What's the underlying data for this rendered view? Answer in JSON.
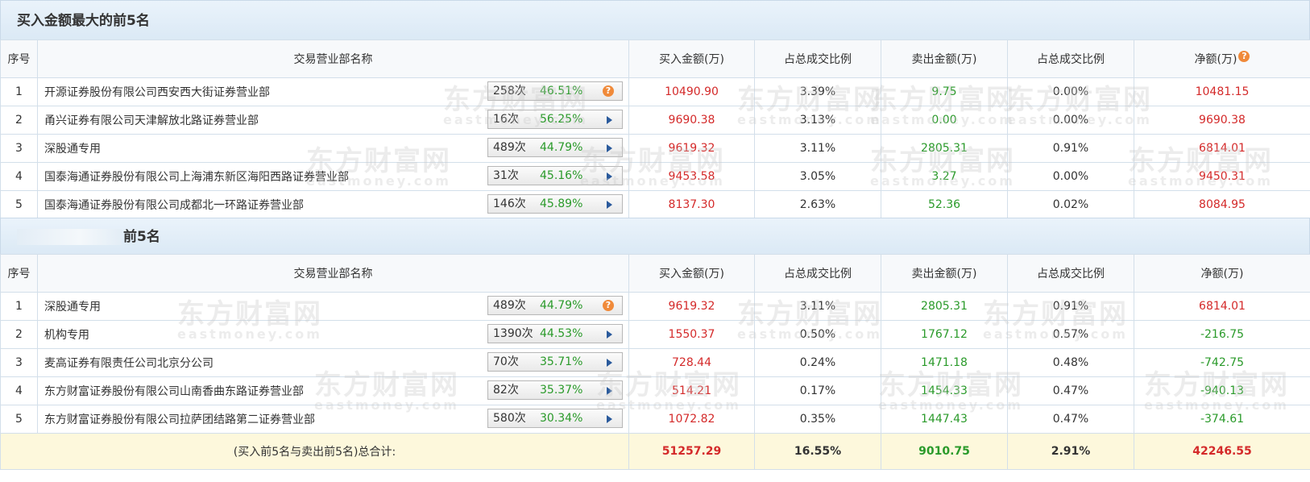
{
  "buy_section": {
    "title": "买入金额最大的前5名",
    "headers": [
      "序号",
      "交易营业部名称",
      "买入金额(万)",
      "占总成交比例",
      "卖出金额(万)",
      "占总成交比例",
      "净额(万)"
    ],
    "net_help_icon": "?",
    "rows": [
      {
        "no": "1",
        "name": "开源证券股份有限公司西安西大街证券营业部",
        "count": "258次",
        "pct": "46.51%",
        "icon": "help-icon",
        "buy": "10490.90",
        "buy_ratio": "3.39%",
        "sell": "9.75",
        "sell_ratio": "0.00%",
        "net": "10481.15"
      },
      {
        "no": "2",
        "name": "甬兴证券有限公司天津解放北路证券营业部",
        "count": "16次",
        "pct": "56.25%",
        "icon": "arrow-icon",
        "buy": "9690.38",
        "buy_ratio": "3.13%",
        "sell": "0.00",
        "sell_ratio": "0.00%",
        "net": "9690.38"
      },
      {
        "no": "3",
        "name": "深股通专用",
        "count": "489次",
        "pct": "44.79%",
        "icon": "arrow-icon",
        "buy": "9619.32",
        "buy_ratio": "3.11%",
        "sell": "2805.31",
        "sell_ratio": "0.91%",
        "net": "6814.01"
      },
      {
        "no": "4",
        "name": "国泰海通证券股份有限公司上海浦东新区海阳西路证券营业部",
        "count": "31次",
        "pct": "45.16%",
        "icon": "arrow-icon",
        "buy": "9453.58",
        "buy_ratio": "3.05%",
        "sell": "3.27",
        "sell_ratio": "0.00%",
        "net": "9450.31"
      },
      {
        "no": "5",
        "name": "国泰海通证券股份有限公司成都北一环路证券营业部",
        "count": "146次",
        "pct": "45.89%",
        "icon": "arrow-icon",
        "buy": "8137.30",
        "buy_ratio": "2.63%",
        "sell": "52.36",
        "sell_ratio": "0.02%",
        "net": "8084.95"
      }
    ]
  },
  "sell_section": {
    "title": "前5名",
    "headers": [
      "序号",
      "交易营业部名称",
      "买入金额(万)",
      "占总成交比例",
      "卖出金额(万)",
      "占总成交比例",
      "净额(万)"
    ],
    "rows": [
      {
        "no": "1",
        "name": "深股通专用",
        "count": "489次",
        "pct": "44.79%",
        "icon": "help-icon",
        "buy": "9619.32",
        "buy_ratio": "3.11%",
        "sell": "2805.31",
        "sell_ratio": "0.91%",
        "net": "6814.01"
      },
      {
        "no": "2",
        "name": "机构专用",
        "count": "1390次",
        "pct": "44.53%",
        "icon": "arrow-icon",
        "buy": "1550.37",
        "buy_ratio": "0.50%",
        "sell": "1767.12",
        "sell_ratio": "0.57%",
        "net": "-216.75"
      },
      {
        "no": "3",
        "name": "麦高证券有限责任公司北京分公司",
        "count": "70次",
        "pct": "35.71%",
        "icon": "arrow-icon",
        "buy": "728.44",
        "buy_ratio": "0.24%",
        "sell": "1471.18",
        "sell_ratio": "0.48%",
        "net": "-742.75"
      },
      {
        "no": "4",
        "name": "东方财富证券股份有限公司山南香曲东路证券营业部",
        "count": "82次",
        "pct": "35.37%",
        "icon": "arrow-icon",
        "buy": "514.21",
        "buy_ratio": "0.17%",
        "sell": "1454.33",
        "sell_ratio": "0.47%",
        "net": "-940.13"
      },
      {
        "no": "5",
        "name": "东方财富证券股份有限公司拉萨团结路第二证券营业部",
        "count": "580次",
        "pct": "30.34%",
        "icon": "arrow-icon",
        "buy": "1072.82",
        "buy_ratio": "0.35%",
        "sell": "1447.43",
        "sell_ratio": "0.47%",
        "net": "-374.61"
      }
    ],
    "total": {
      "label": "(买入前5名与卖出前5名)总合计:",
      "buy": "51257.29",
      "buy_ratio": "16.55%",
      "sell": "9010.75",
      "sell_ratio": "2.91%",
      "net": "42246.55"
    }
  },
  "watermark": {
    "cn": "东方财富网",
    "en": "eastmoney.com"
  },
  "colors": {
    "buy": "#d42a2a",
    "sell": "#2a9a2a",
    "header_bg": "#dbe9f5",
    "total_bg": "#fdf8dc"
  }
}
